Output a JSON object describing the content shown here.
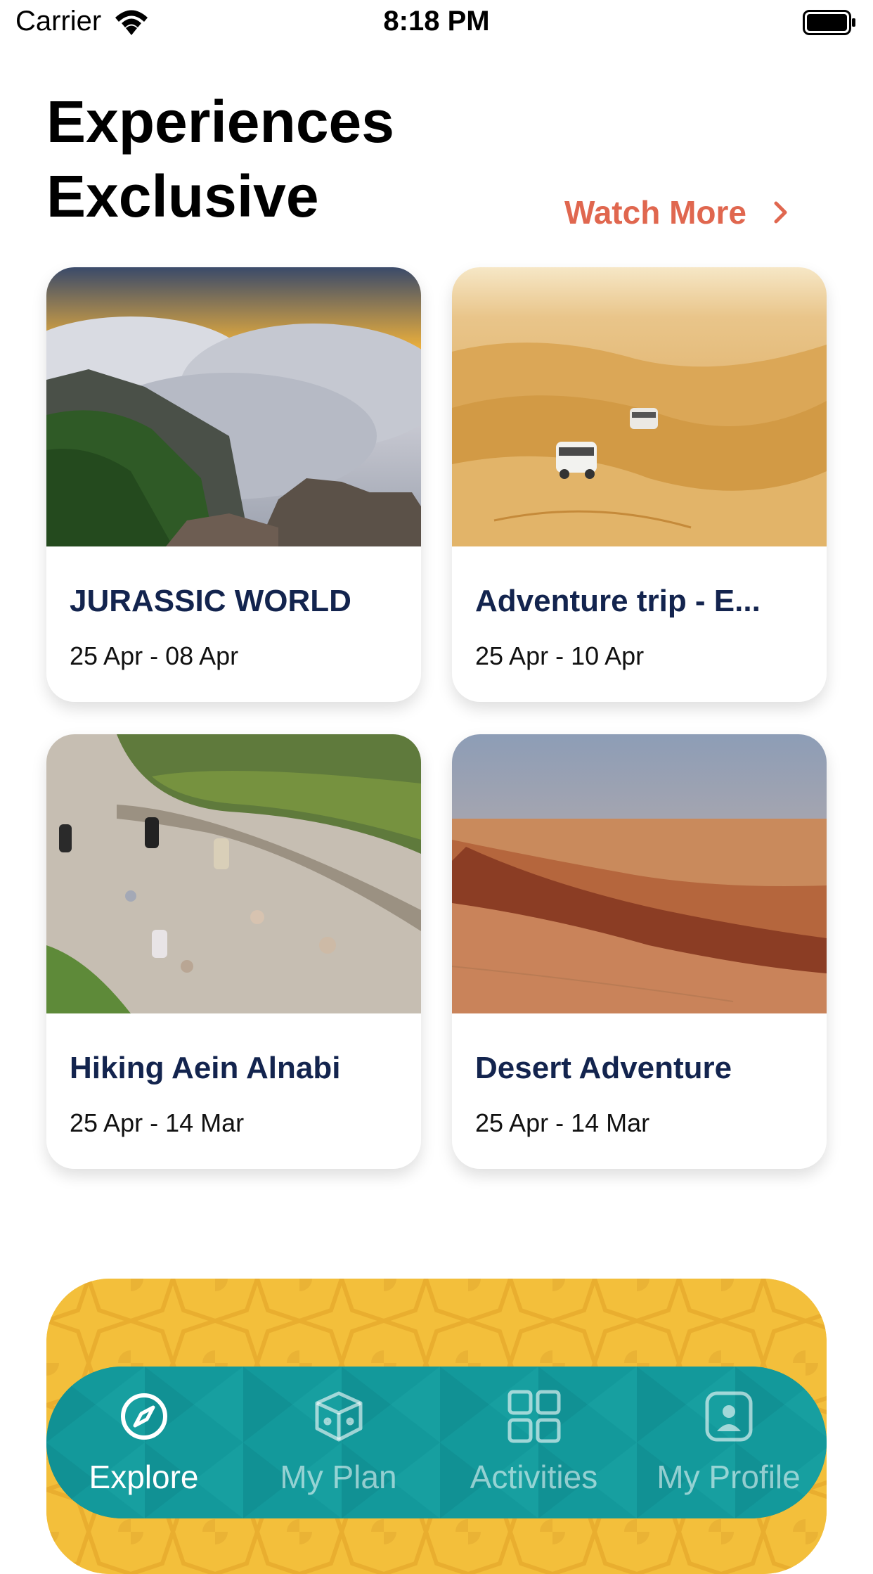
{
  "status_bar": {
    "carrier": "Carrier",
    "time": "8:18 PM"
  },
  "header": {
    "title_line1": "Experiences",
    "title_line2": "Exclusive",
    "watch_more_label": "Watch More"
  },
  "experiences": [
    {
      "title": "JURASSIC WORLD",
      "dates": "25 Apr - 08 Apr",
      "image": "mountain-clouds-sunset"
    },
    {
      "title": "Adventure trip - E...",
      "dates": "25 Apr - 10 Apr",
      "image": "desert-dunes-suv"
    },
    {
      "title": "Hiking Aein Alnabi",
      "dates": "25 Apr - 14 Mar",
      "image": "hiking-stone-path"
    },
    {
      "title": "Desert Adventure",
      "dates": "25 Apr - 14 Mar",
      "image": "red-sand-dunes"
    }
  ],
  "tab_bar": {
    "active": "explore",
    "tabs": [
      {
        "id": "explore",
        "label": "Explore",
        "icon": "compass-icon"
      },
      {
        "id": "my-plan",
        "label": "My Plan",
        "icon": "cube-icon"
      },
      {
        "id": "activities",
        "label": "Activities",
        "icon": "grid-icon"
      },
      {
        "id": "my-profile",
        "label": "My Profile",
        "icon": "profile-icon"
      }
    ]
  },
  "colors": {
    "accent": "#e0674f",
    "card_title": "#13244e",
    "tab_bar": "#13999b",
    "promo_banner": "#f3bf3b"
  }
}
